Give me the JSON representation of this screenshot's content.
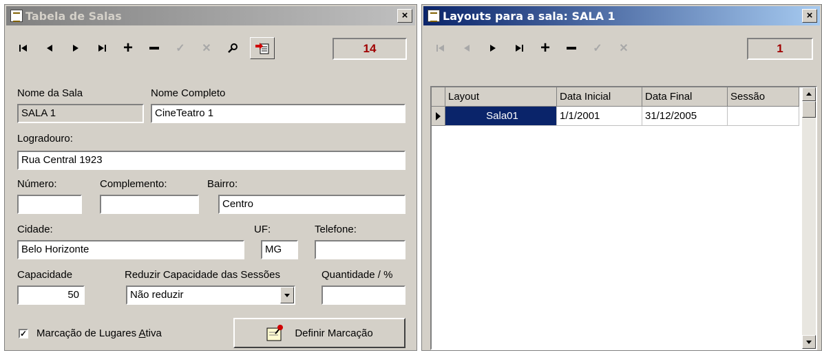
{
  "left_window": {
    "title": "Tabela de Salas",
    "close_label": "×",
    "record_count": "14",
    "nome_sala": {
      "label": "Nome da Sala",
      "value": "SALA 1"
    },
    "nome_completo": {
      "label": "Nome Completo",
      "value": "CineTeatro 1"
    },
    "logradouro": {
      "label": "Logradouro:",
      "value": "Rua Central 1923"
    },
    "numero": {
      "label": "Número:",
      "value": ""
    },
    "complemento": {
      "label": "Complemento:",
      "value": ""
    },
    "bairro": {
      "label": "Bairro:",
      "value": "Centro"
    },
    "cidade": {
      "label": "Cidade:",
      "value": "Belo Horizonte"
    },
    "uf": {
      "label": "UF:",
      "value": "MG"
    },
    "telefone": {
      "label": "Telefone:",
      "value": ""
    },
    "capacidade": {
      "label": "Capacidade",
      "value": "50"
    },
    "reduzir": {
      "label": "Reduzir Capacidade das Sessões",
      "value": "Não reduzir"
    },
    "quantidade": {
      "label": "Quantidade / %",
      "value": ""
    },
    "marcacao_checkbox": {
      "label_before": "Marcação de Lugares ",
      "label_underlined": "A",
      "label_after": "tiva",
      "checked": true,
      "mark": "✓"
    },
    "definir_button": {
      "label": "Definir Marcação"
    }
  },
  "right_window": {
    "title": "Layouts para a sala: SALA 1",
    "close_label": "×",
    "record_count": "1",
    "grid": {
      "columns": [
        "Layout",
        "Data Inicial",
        "Data Final",
        "Sessão"
      ],
      "rows": [
        {
          "layout": "Sala01",
          "data_inicial": "1/1/2001",
          "data_final": "31/12/2005",
          "sessao": ""
        }
      ]
    }
  },
  "toolbar_icons": {
    "first": "⏮",
    "prior": "◀",
    "next": "▶",
    "last": "⏭",
    "edit": "✓",
    "cancel": "✕",
    "search": "⚲"
  },
  "colors": {
    "count_text": "#a00000",
    "selection": "#0a246a",
    "title_active": "#0a246a"
  }
}
